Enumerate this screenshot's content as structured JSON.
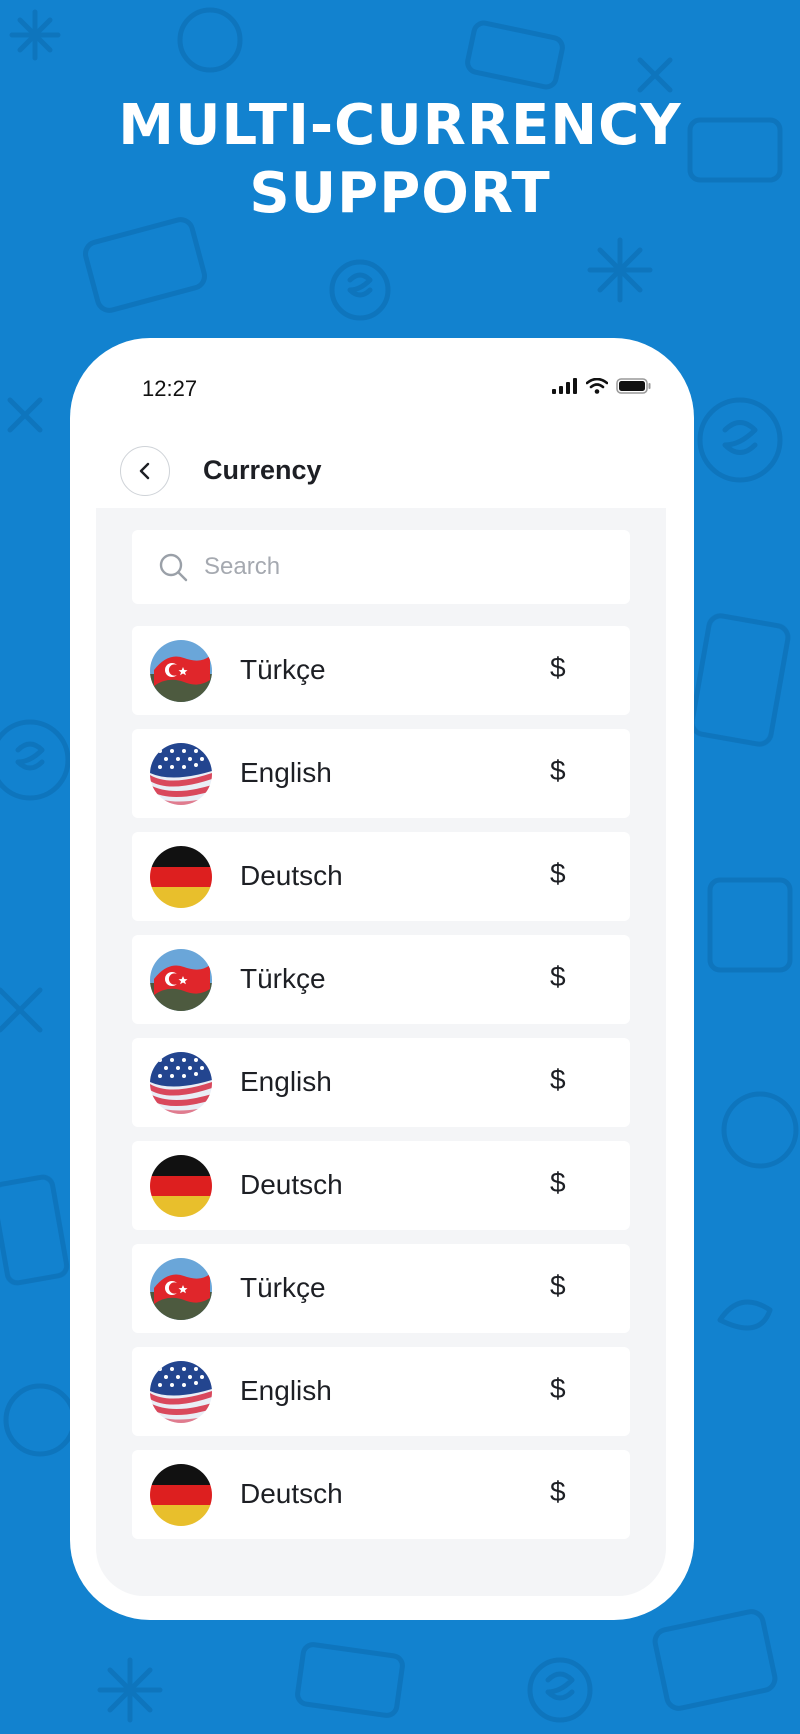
{
  "headline": {
    "line1": "MULTI-CURRENCY",
    "line2": "SUPPORT"
  },
  "colors": {
    "background": "#1282cf",
    "phone": "#ffffff",
    "content_bg": "#f4f5f7",
    "text": "#1d1f24"
  },
  "status_bar": {
    "time": "12:27",
    "icons": [
      "signal-icon",
      "wifi-icon",
      "battery-icon"
    ]
  },
  "nav": {
    "back_icon": "chevron-left-icon",
    "title": "Currency"
  },
  "search": {
    "placeholder": "Search",
    "value": "",
    "icon": "search-icon"
  },
  "currencies": [
    {
      "label": "Türkçe",
      "symbol": "$",
      "flag": "turkey-flag-icon"
    },
    {
      "label": "English",
      "symbol": "$",
      "flag": "usa-flag-icon"
    },
    {
      "label": "Deutsch",
      "symbol": "$",
      "flag": "germany-flag-icon"
    },
    {
      "label": "Türkçe",
      "symbol": "$",
      "flag": "turkey-flag-icon"
    },
    {
      "label": "English",
      "symbol": "$",
      "flag": "usa-flag-icon"
    },
    {
      "label": "Deutsch",
      "symbol": "$",
      "flag": "germany-flag-icon"
    },
    {
      "label": "Türkçe",
      "symbol": "$",
      "flag": "turkey-flag-icon"
    },
    {
      "label": "English",
      "symbol": "$",
      "flag": "usa-flag-icon"
    },
    {
      "label": "Deutsch",
      "symbol": "$",
      "flag": "germany-flag-icon"
    }
  ]
}
